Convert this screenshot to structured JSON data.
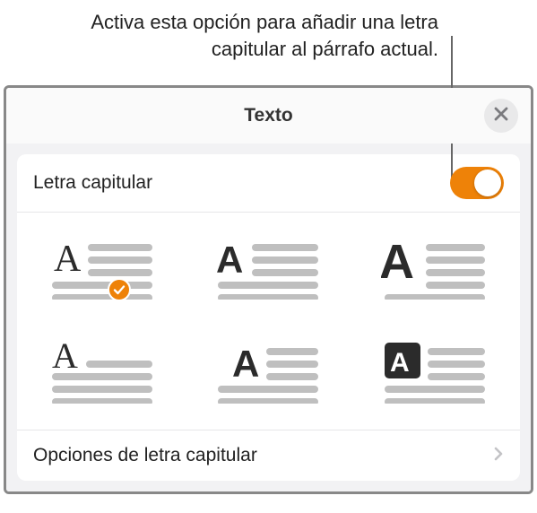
{
  "callout": {
    "text": "Activa esta opción para añadir una letra capitular al párrafo actual."
  },
  "panel": {
    "title": "Texto",
    "close_icon": "close-icon"
  },
  "dropcap": {
    "toggle_label": "Letra capitular",
    "toggle_on": true,
    "selected_style_index": 0,
    "options_label": "Opciones de letra capitular"
  },
  "colors": {
    "accent": "#ee8208",
    "line_gray": "#bfbfbf",
    "dark": "#2b2b2b"
  }
}
